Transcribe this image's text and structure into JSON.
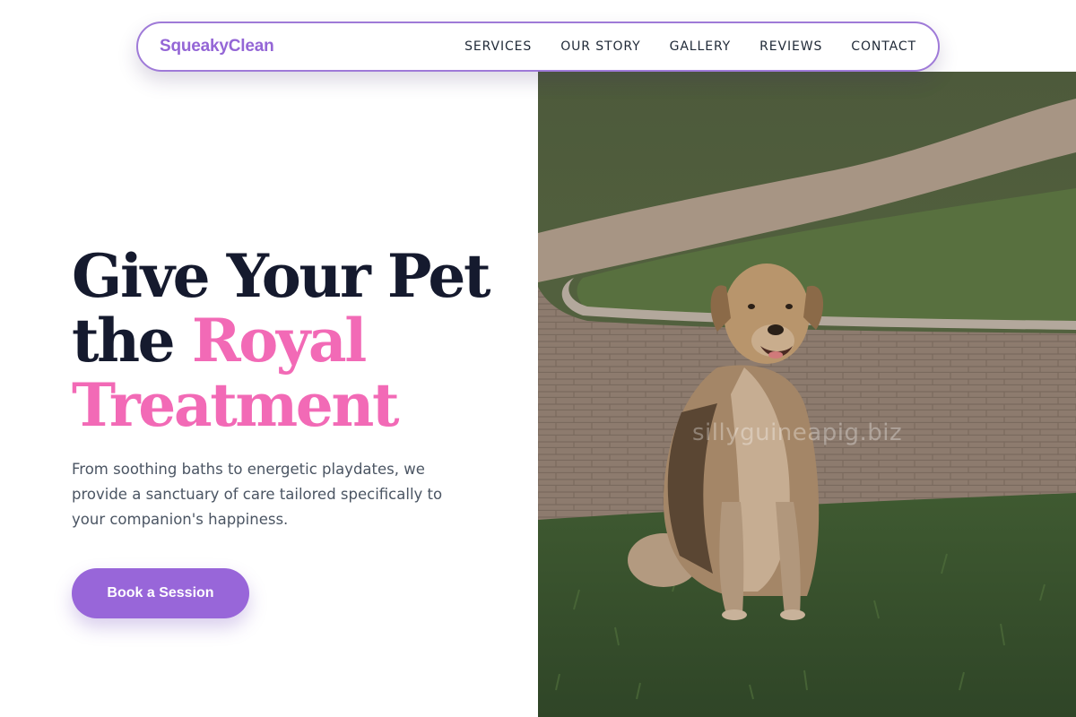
{
  "brand": {
    "name": "SqueakyClean"
  },
  "nav": {
    "links": [
      "SERVICES",
      "OUR STORY",
      "GALLERY",
      "REVIEWS",
      "CONTACT"
    ]
  },
  "hero": {
    "title_line1": "Give Your Pet",
    "title_line2_prefix": "the",
    "title_line2_accent": "Royal",
    "title_line3_accent": "Treatment",
    "subtitle": "From soothing baths to energetic playdates, we provide a sanctuary of care tailored specifically to your companion's happiness.",
    "cta_label": "Book a Session",
    "image_watermark": "sillyguineapig.biz"
  },
  "colors": {
    "brand_purple": "#9466d6",
    "accent_pink": "#f26ab6",
    "heading_navy": "#151a2e",
    "cta_purple": "#9866d9"
  }
}
